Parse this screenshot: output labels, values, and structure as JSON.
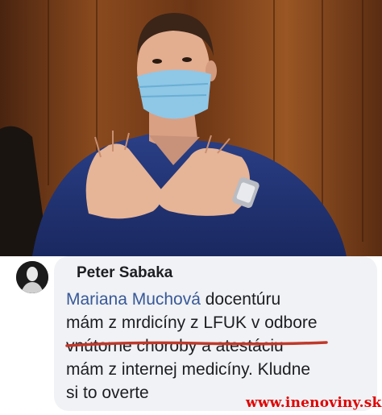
{
  "photo": {
    "subject_icon": "doctor-photo"
  },
  "comment": {
    "avatar_icon": "profile-avatar",
    "author": "Peter Sabaka",
    "mention": "Mariana Muchová",
    "text_after_mention": " docentúru",
    "lines": [
      "mám z mrdicíny z LFUK v odbore",
      "vnútorne choroby a atestáciu",
      "mám z internej medicíny. Kludne",
      "si to overte"
    ]
  },
  "watermark": {
    "text": "www.inenoviny.sk",
    "color": "#e00000"
  },
  "colors": {
    "mention": "#385898",
    "bubble": "#f0f2f5",
    "underline": "#c0392b"
  }
}
